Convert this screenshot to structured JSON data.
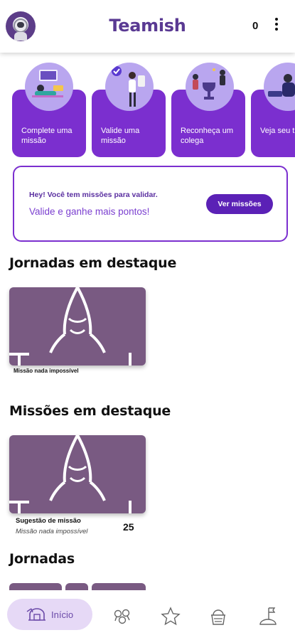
{
  "header": {
    "title": "Teamish",
    "points": "0"
  },
  "cards": [
    {
      "label": "Complete uma missão"
    },
    {
      "label": "Valide uma missão"
    },
    {
      "label": "Reconheça um colega"
    },
    {
      "label": "Veja seu t"
    }
  ],
  "banner": {
    "title": "Hey! Você tem missões para validar.",
    "subtitle": "Valide e ganhe mais pontos!",
    "button_label": "Ver missões"
  },
  "sections": {
    "featured_journeys": {
      "title": "Jornadas em destaque",
      "items": [
        {
          "name": "Missão nada impossível"
        }
      ]
    },
    "featured_missions": {
      "title": "Missões em destaque",
      "items": [
        {
          "type": "Sugestão de missão",
          "name": "Missão nada impossível",
          "count": "25"
        }
      ]
    },
    "journeys": {
      "title": "Jornadas"
    }
  },
  "bottom_nav": {
    "home_label": "Início",
    "icons": [
      "home-icon",
      "achievements-icon",
      "star-icon",
      "basket-icon",
      "moon-flag-icon"
    ]
  },
  "colors": {
    "brand_purple": "#7b2fcf",
    "dark_purple": "#5b21b6",
    "title_purple": "#5a3a93",
    "thumbnail_mauve": "#795a82"
  }
}
